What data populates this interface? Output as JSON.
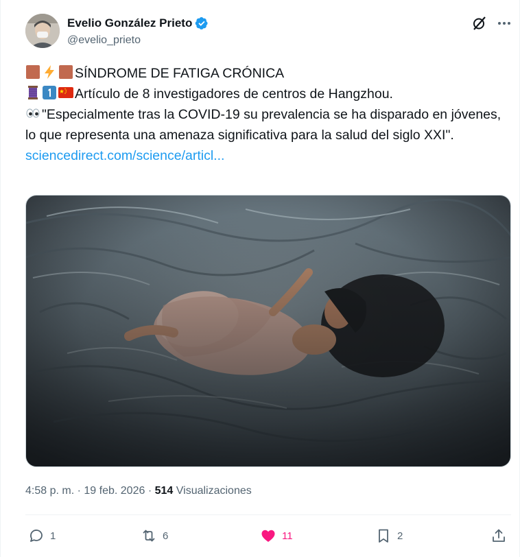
{
  "author": {
    "name": "Evelio González Prieto",
    "handle": "@evelio_prieto",
    "verified": true
  },
  "tweet": {
    "line1": "SÍNDROME DE FATIGA CRÓNICA",
    "line1_emojis": [
      "brown-square",
      "lightning",
      "brown-square"
    ],
    "line2": "Artículo de 8 investigadores de centros de Hangzhou.",
    "line2_emojis": [
      "thread-spool",
      "keycap-1",
      "china-flag"
    ],
    "line3": "\"Especialmente tras la COVID-19 su prevalencia se ha disparado en jóvenes, lo que representa una amenaza significativa para la salud del siglo XXI\".",
    "line3_emojis": [
      "eyes"
    ],
    "link_text": "sciencedirect.com/science/articl..."
  },
  "media": {
    "description_icon": "photo"
  },
  "meta": {
    "time": "4:58 p. m.",
    "separator": "·",
    "date": "19 feb. 2026",
    "views_count": "514",
    "views_label": "Visualizaciones"
  },
  "actions": {
    "replies": "1",
    "reposts": "6",
    "likes": "11",
    "bookmarks": "2"
  },
  "colors": {
    "accent": "#1d9bf0",
    "like": "#f91880",
    "secondary_text": "#536471"
  }
}
